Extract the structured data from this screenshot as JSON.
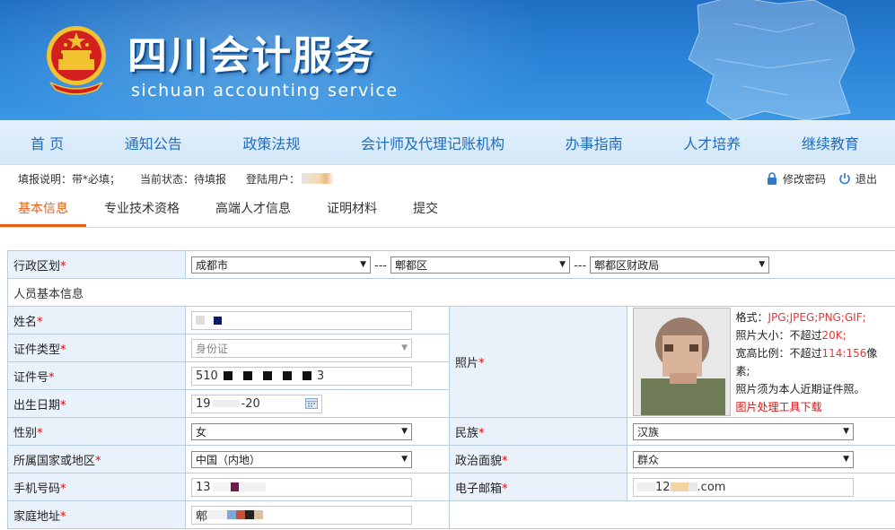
{
  "header": {
    "title": "四川会计服务",
    "subtitle": "sichuan accounting service"
  },
  "nav": [
    "首 页",
    "通知公告",
    "政策法规",
    "会计师及代理记账机构",
    "办事指南",
    "人才培养",
    "继续教育"
  ],
  "infobar": {
    "fill_note": "填报说明：带*必填；",
    "status": "当前状态：待填报",
    "user_label": "登陆用户：",
    "change_password": "修改密码",
    "logout": "退出"
  },
  "tabs": [
    "基本信息",
    "专业技术资格",
    "高端人才信息",
    "证明材料",
    "提交"
  ],
  "form": {
    "region_label": "行政区划",
    "region_city": "成都市",
    "region_district": "郫都区",
    "region_bureau": "郫都区财政局",
    "region_sep": "---",
    "section_title": "人员基本信息",
    "name_label": "姓名",
    "idtype_label": "证件类型",
    "idtype_value": "身份证",
    "idno_label": "证件号",
    "idno_prefix": "510",
    "idno_suffix": "3",
    "birth_label": "出生日期",
    "birth_prefix": "19",
    "birth_suffix": "-20",
    "photo_label": "照片",
    "photo_format_label": "格式：",
    "photo_format_value": "JPG;JPEG;PNG;GIF;",
    "photo_size_label": "照片大小：不超过",
    "photo_size_value": "20K;",
    "photo_ratio_label": "宽高比例：不超过",
    "photo_ratio_value": "114:156",
    "photo_ratio_unit": "像素;",
    "photo_recent": "照片须为本人近期证件照。",
    "photo_tool_link": "图片处理工具下载",
    "gender_label": "性别",
    "gender_value": "女",
    "ethnic_label": "民族",
    "ethnic_value": "汉族",
    "country_label": "所属国家或地区",
    "country_value": "中国（内地）",
    "political_label": "政治面貌",
    "political_value": "群众",
    "phone_label": "手机号码",
    "phone_prefix": "13",
    "email_label": "电子邮箱",
    "email_mid": "12",
    "email_suffix": ".com",
    "address_label": "家庭地址",
    "address_prefix": "郫"
  },
  "colors": {
    "banner": "#2b86d9",
    "nav_text": "#1f6cc0",
    "tab_active": "#e3631b",
    "label_bg": "#e9f2fb",
    "required": "#ee0000"
  }
}
